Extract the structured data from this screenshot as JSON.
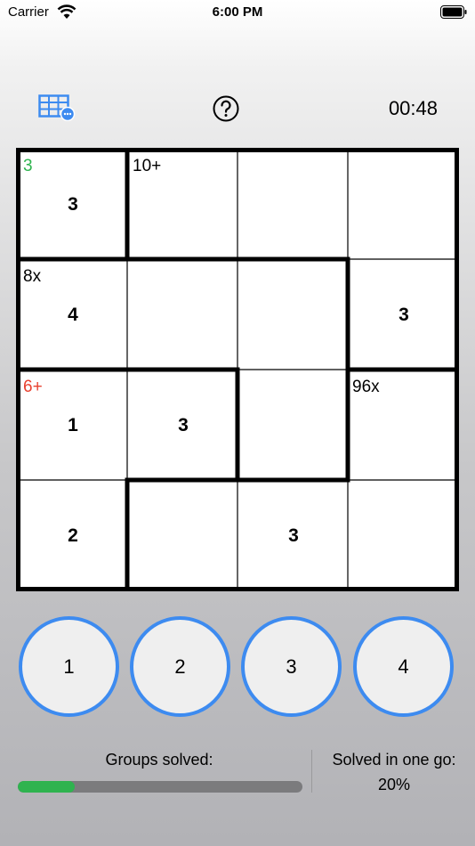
{
  "status_bar": {
    "carrier": "Carrier",
    "time": "6:00 PM"
  },
  "toolbar": {
    "grid_icon": "grid-menu-icon",
    "help_icon": "help-icon",
    "timer": "00:48"
  },
  "board": {
    "cells": [
      [
        "3",
        "",
        "",
        ""
      ],
      [
        "4",
        "",
        "",
        "3"
      ],
      [
        "1",
        "3",
        "",
        ""
      ],
      [
        "2",
        "",
        "3",
        ""
      ]
    ],
    "cages": [
      {
        "label": "3",
        "color": "#2fb34f"
      },
      {
        "label": "10+",
        "color": "#000000"
      },
      {
        "label": "8x",
        "color": "#000000"
      },
      {
        "label": "6+",
        "color": "#e8412f"
      },
      {
        "label": "96x",
        "color": "#000000"
      }
    ]
  },
  "keypad": [
    "1",
    "2",
    "3",
    "4"
  ],
  "footer": {
    "groups_label": "Groups solved:",
    "groups_progress": 0.2,
    "onego_label": "Solved in one go:",
    "onego_value": "20%"
  },
  "colors": {
    "accent": "#3d8bf0",
    "progress": "#2fb34f",
    "track": "#7b7b7d"
  }
}
